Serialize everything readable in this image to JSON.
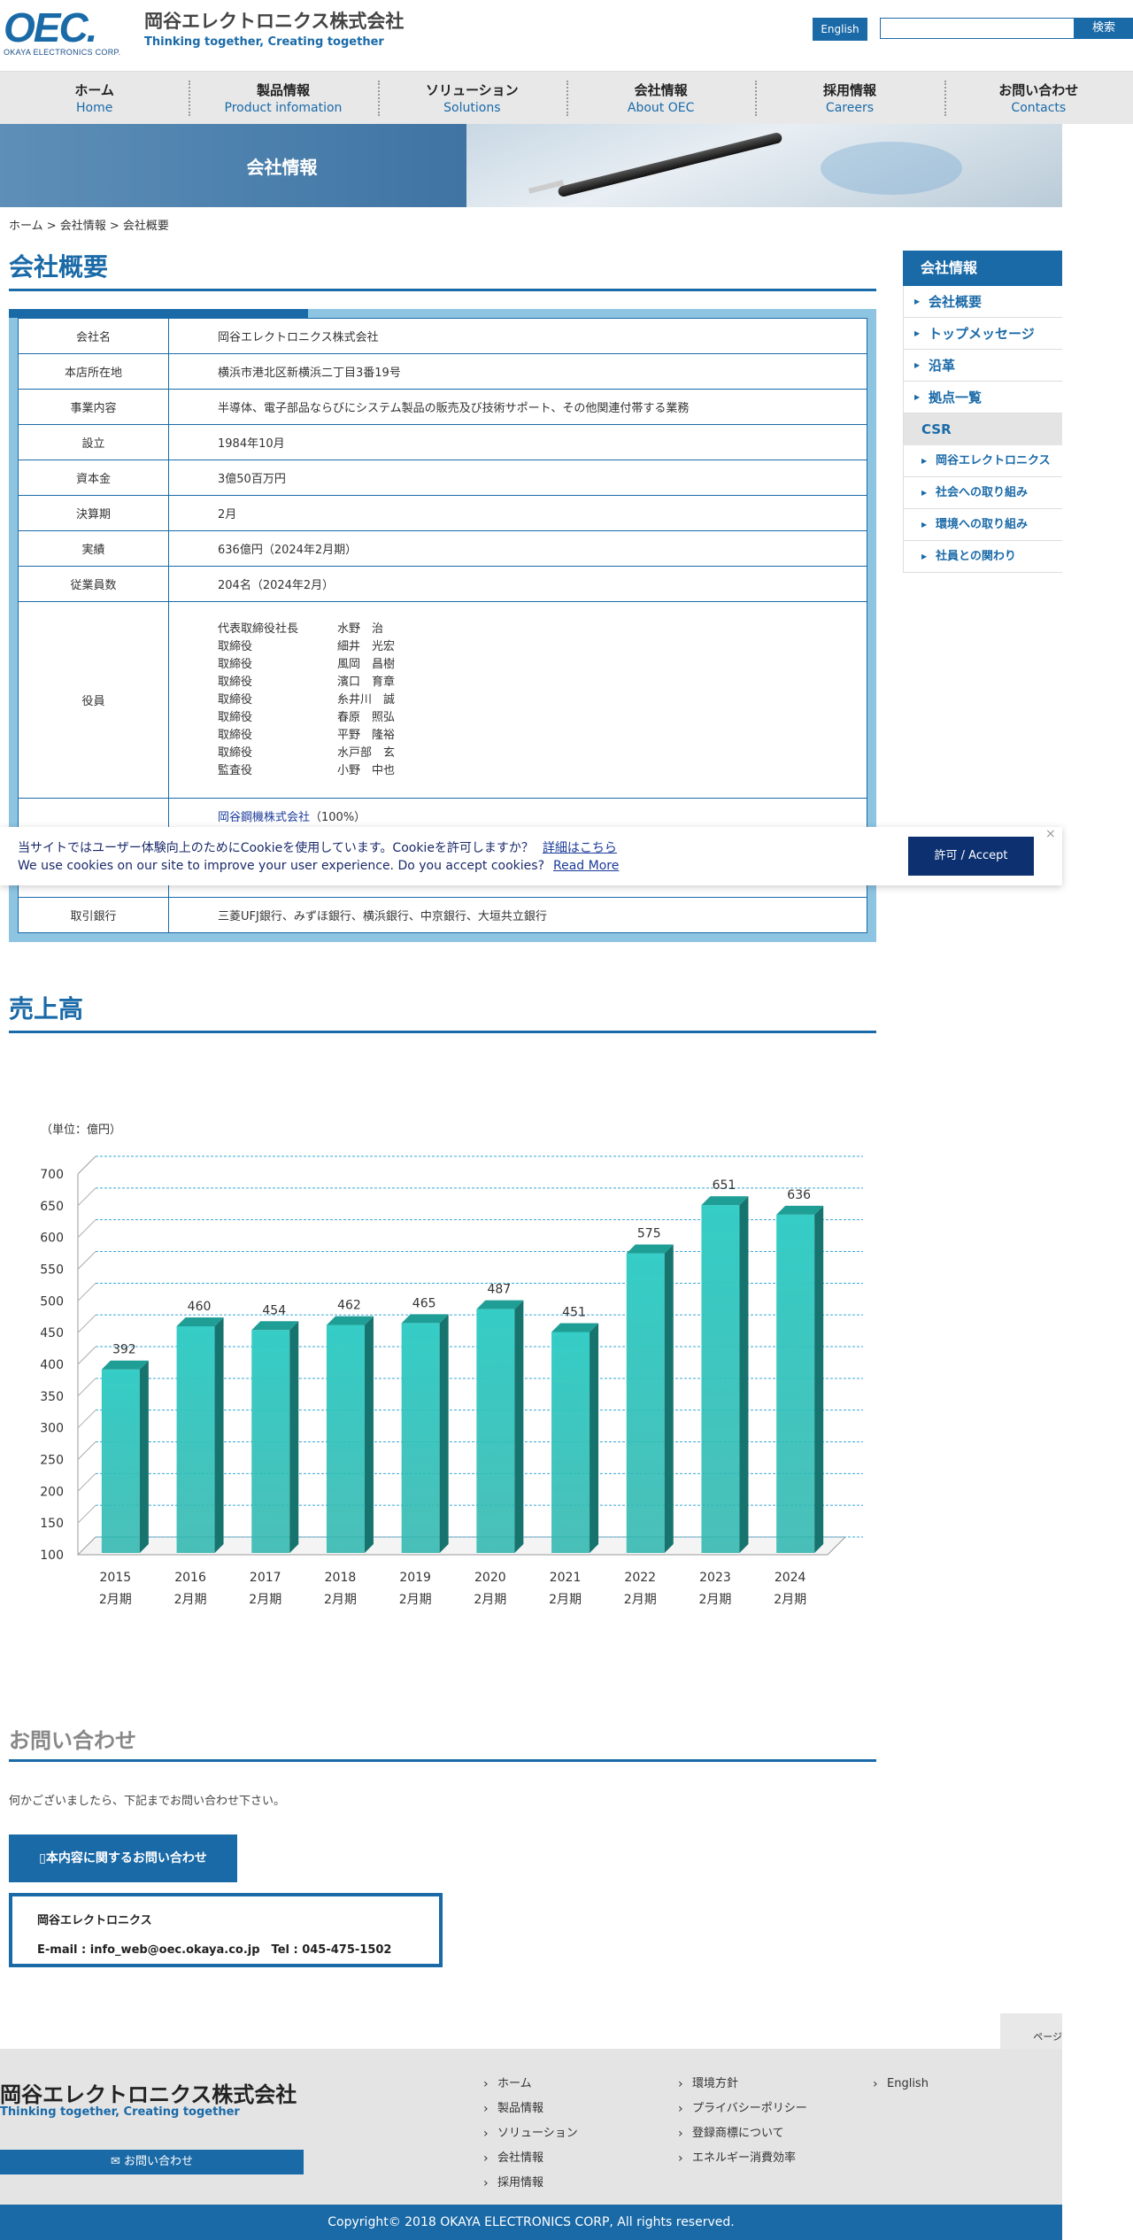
{
  "header": {
    "logo_mark": "OEC.",
    "logo_sub": "OKAYA ELECTRONICS CORP.",
    "company_name": "岡谷エレクトロニクス株式会社",
    "company_tag": "Thinking together, Creating together",
    "english_label": "English",
    "search_label": "検索"
  },
  "nav": [
    {
      "ja": "ホーム",
      "en": "Home"
    },
    {
      "ja": "製品情報",
      "en": "Product infomation"
    },
    {
      "ja": "ソリューション",
      "en": "Solutions"
    },
    {
      "ja": "会社情報",
      "en": "About OEC"
    },
    {
      "ja": "採用情報",
      "en": "Careers"
    },
    {
      "ja": "お問い合わせ",
      "en": "Contacts"
    }
  ],
  "banner": {
    "title": "会社情報"
  },
  "breadcrumb": "ホーム > 会社情報 > 会社概要",
  "overview": {
    "heading": "会社概要",
    "rows": [
      {
        "label": "会社名",
        "value": "岡谷エレクトロニクス株式会社"
      },
      {
        "label": "本店所在地",
        "value": "横浜市港北区新横浜二丁目3番19号"
      },
      {
        "label": "事業内容",
        "value": "半導体、電子部品ならびにシステム製品の販売及び技術サポート、その他関連付帯する業務"
      },
      {
        "label": "設立",
        "value": "1984年10月"
      },
      {
        "label": "資本金",
        "value": "3億50百万円"
      },
      {
        "label": "決算期",
        "value": "2月"
      },
      {
        "label": "実績",
        "value": "636億円（2024年2月期）"
      },
      {
        "label": "従業員数",
        "value": "204名（2024年2月）"
      }
    ],
    "officers_label": "役員",
    "officers": [
      {
        "role": "代表取締役社長",
        "name": "水野　治"
      },
      {
        "role": "取締役",
        "name": "細井　光宏"
      },
      {
        "role": "取締役",
        "name": "風岡　昌樹"
      },
      {
        "role": "取締役",
        "name": "濱口　育章"
      },
      {
        "role": "取締役",
        "name": "糸井川　誠"
      },
      {
        "role": "取締役",
        "name": "春原　照弘"
      },
      {
        "role": "取締役",
        "name": "平野　隆裕"
      },
      {
        "role": "取締役",
        "name": "水戸部　玄"
      },
      {
        "role": "監査役",
        "name": "小野　中也"
      }
    ],
    "shareholder_link": "岡谷鋼機株式会社",
    "shareholder_pct": "（100%）",
    "bank_label": "取引銀行",
    "bank_value": "三菱UFJ銀行、みずほ銀行、横浜銀行、中京銀行、大垣共立銀行"
  },
  "cookie": {
    "ja_text": "当サイトではユーザー体験向上のためにCookieを使用しています。Cookieを許可しますか？",
    "ja_link": "詳細はこちら",
    "en_text": "We use cookies on our site to improve your user experience. Do you accept cookies?",
    "en_link": "Read More",
    "accept": "許可 / Accept",
    "close": "×"
  },
  "sales": {
    "heading": "売上高"
  },
  "chart_data": {
    "type": "bar",
    "unit_label": "（単位：億円）",
    "categories": [
      "2015",
      "2016",
      "2017",
      "2018",
      "2019",
      "2020",
      "2021",
      "2022",
      "2023",
      "2024"
    ],
    "category_sub": "2月期",
    "values": [
      392,
      460,
      454,
      462,
      465,
      487,
      451,
      575,
      651,
      636
    ],
    "ylim": [
      100,
      700
    ],
    "yticks": [
      100,
      150,
      200,
      250,
      300,
      350,
      400,
      450,
      500,
      550,
      600,
      650,
      700
    ],
    "grid": true,
    "bar_color": "#2bb5ad"
  },
  "contact": {
    "heading": "お問い合わせ",
    "text": "何かございましたら、下記までお問い合わせ下さい。",
    "button": "本内容に関するお問い合わせ",
    "box_name": "岡谷エレクトロニクス",
    "box_info": "E-mail : info_web@oec.okaya.co.jp　Tel : 045-475-1502"
  },
  "pagetop": "ページ",
  "sidebar": {
    "head": "会社情報",
    "items": [
      "会社概要",
      "トップメッセージ",
      "沿革",
      "拠点一覧"
    ],
    "csr": "CSR",
    "csr_items": [
      "岡谷エレクトロニクス",
      "社会への取り組み",
      "環境への取り組み",
      "社員との関わり"
    ]
  },
  "footer": {
    "name": "岡谷エレクトロニクス株式会社",
    "tag": "Thinking together, Creating together",
    "contact": "お問い合わせ",
    "col1": [
      "ホーム",
      "製品情報",
      "ソリューション",
      "会社情報",
      "採用情報"
    ],
    "col2": [
      "環境方針",
      "プライバシーポリシー",
      "登録商標について",
      "エネルギー消費効率"
    ],
    "col3": [
      "English"
    ],
    "copyright": "Copyright© 2018 OKAYA ELECTRONICS CORP, All rights reserved."
  }
}
